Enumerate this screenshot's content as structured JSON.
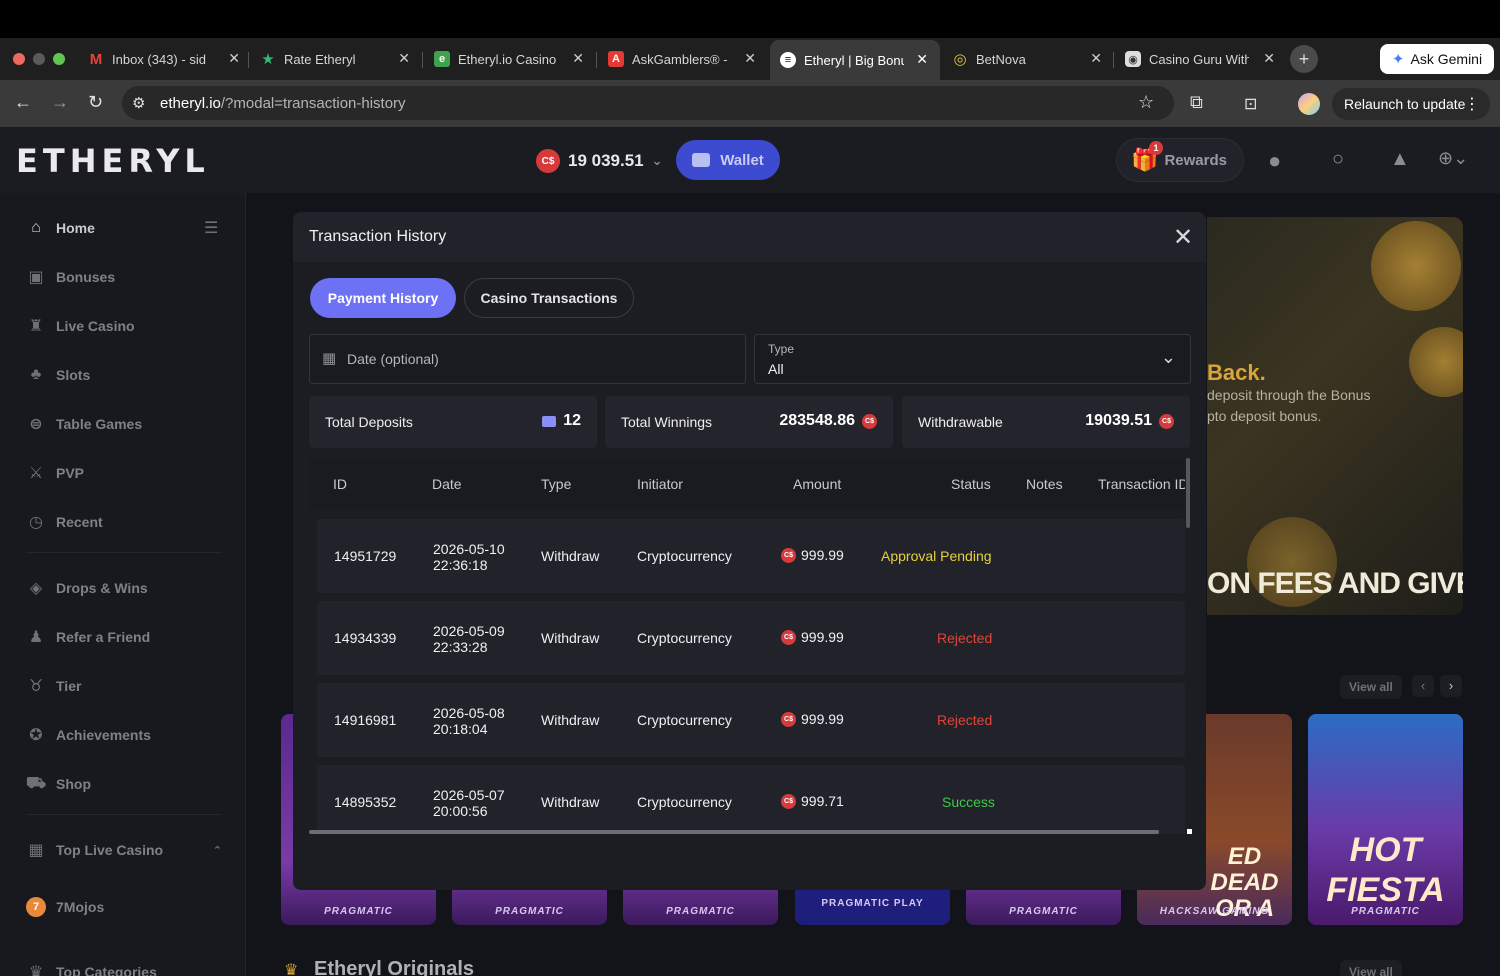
{
  "browser": {
    "tabs": [
      {
        "label": "Inbox (343) - sid",
        "icon": "gmail-icon"
      },
      {
        "label": "Rate Etheryl",
        "icon": "star-icon"
      },
      {
        "label": "Etheryl.io Casino",
        "icon": "site-icon"
      },
      {
        "label": "AskGamblers® -",
        "icon": "askgamblers-icon"
      },
      {
        "label": "Etheryl | Big Bonu",
        "icon": "etheryl-icon"
      },
      {
        "label": "BetNova",
        "icon": "betnova-icon"
      },
      {
        "label": "Casino Guru With",
        "icon": "casinoguru-icon"
      }
    ],
    "active_tab": 4,
    "new_tab": "+",
    "ask_gemini": "Ask Gemini",
    "url_host": "etheryl.io",
    "url_path": "/?modal=transaction-history",
    "relaunch": "Relaunch to update"
  },
  "site": {
    "logo": "ETHERYL",
    "balance": "19 039.51",
    "currency_badge": "C$",
    "wallet_label": "Wallet",
    "rewards_label": "Rewards",
    "rewards_badge": "1"
  },
  "sidebar": {
    "items": [
      {
        "label": "Home",
        "icon": "home-icon"
      },
      {
        "label": "Bonuses",
        "icon": "gift-icon"
      },
      {
        "label": "Live Casino",
        "icon": "cards-icon"
      },
      {
        "label": "Slots",
        "icon": "slots-icon"
      },
      {
        "label": "Table Games",
        "icon": "table-icon"
      },
      {
        "label": "PVP",
        "icon": "swords-icon"
      },
      {
        "label": "Recent",
        "icon": "clock-icon"
      },
      {
        "label": "Drops & Wins",
        "icon": "drops-icon"
      },
      {
        "label": "Refer a Friend",
        "icon": "users-icon"
      },
      {
        "label": "Tier",
        "icon": "medal-icon"
      },
      {
        "label": "Achievements",
        "icon": "trophy-icon"
      },
      {
        "label": "Shop",
        "icon": "cart-icon"
      },
      {
        "label": "Top Live Casino",
        "icon": "grid-icon"
      },
      {
        "label": "7Mojos",
        "icon": "mojos-icon"
      },
      {
        "label": "Top Categories",
        "icon": "crown-icon"
      }
    ]
  },
  "background": {
    "banner_heading": "Back.",
    "banner_text_1": "deposit through the Bonus",
    "banner_text_2": "pto deposit bonus.",
    "banner_slogan": "ON FEES AND GIVE IT TO YO",
    "view_all": "View all",
    "game_providers": [
      "PRAGMATIC",
      "PRAGMATIC",
      "PRAGMATIC",
      "PRAGMATIC PLAY",
      "PRAGMATIC",
      "HACKSAW GAMING",
      "PRAGMATIC"
    ],
    "game_titles": [
      "",
      "",
      "",
      "",
      "",
      "ED DEAD OR A WILD",
      "HOT FIESTA"
    ],
    "originals": "Etheryl Originals"
  },
  "modal": {
    "title": "Transaction History",
    "tabs": [
      "Payment History",
      "Casino Transactions"
    ],
    "date_placeholder": "Date (optional)",
    "type_label": "Type",
    "type_value": "All",
    "stats": {
      "deposits_label": "Total Deposits",
      "deposits_value": "12",
      "winnings_label": "Total Winnings",
      "winnings_value": "283548.86",
      "withdrawable_label": "Withdrawable",
      "withdrawable_value": "19039.51"
    },
    "columns": [
      "ID",
      "Date",
      "Type",
      "Initiator",
      "Amount",
      "Status",
      "Notes",
      "Transaction ID"
    ],
    "rows": [
      {
        "id": "14951729",
        "date": "2026-05-10",
        "time": "22:36:18",
        "type": "Withdraw",
        "initiator": "Cryptocurrency",
        "amount": "999.99",
        "status": "Approval Pending"
      },
      {
        "id": "14934339",
        "date": "2026-05-09",
        "time": "22:33:28",
        "type": "Withdraw",
        "initiator": "Cryptocurrency",
        "amount": "999.99",
        "status": "Rejected"
      },
      {
        "id": "14916981",
        "date": "2026-05-08",
        "time": "20:18:04",
        "type": "Withdraw",
        "initiator": "Cryptocurrency",
        "amount": "999.99",
        "status": "Rejected"
      },
      {
        "id": "14895352",
        "date": "2026-05-07",
        "time": "20:00:56",
        "type": "Withdraw",
        "initiator": "Cryptocurrency",
        "amount": "999.71",
        "status": "Success"
      }
    ]
  },
  "colors": {
    "accent": "#6d72f5",
    "wallet": "#3c4bd0",
    "pending": "#e6d23a",
    "rejected": "#e0443a",
    "success": "#3fc94a",
    "currency": "#d63a3a"
  }
}
